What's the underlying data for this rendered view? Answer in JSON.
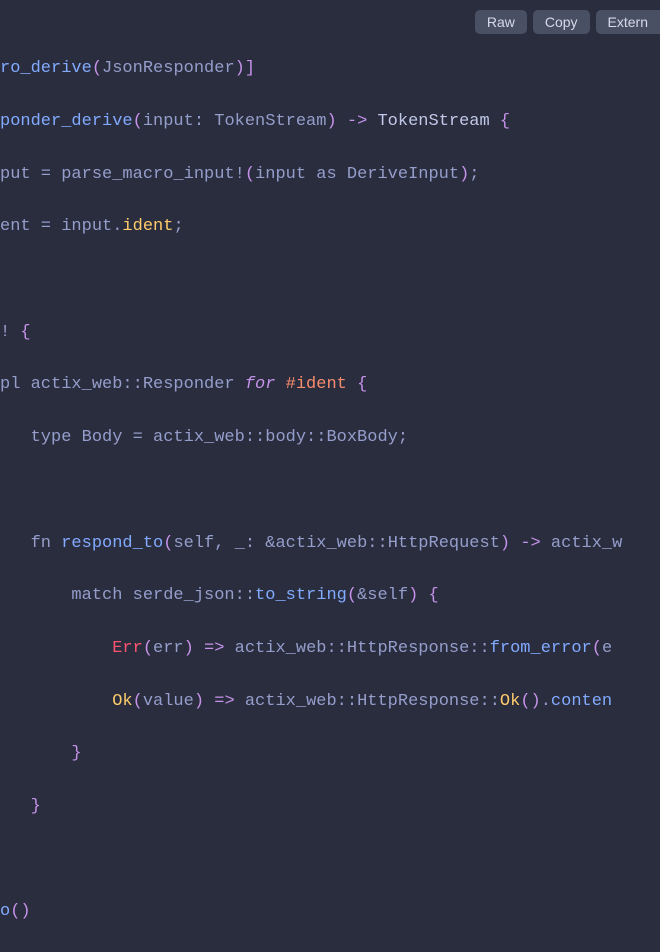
{
  "toolbar": {
    "raw": "Raw",
    "copy": "Copy",
    "extern": "Extern"
  },
  "code": {
    "l1_a": "ro_derive",
    "l1_b": "JsonResponder",
    "l2_a": "ponder_derive",
    "l2_b": "input: TokenStream",
    "l2_c": " TokenStream ",
    "l3_a": "put = parse_macro_input!",
    "l3_b": "input as DeriveInput",
    "l3_c": ";",
    "l4_a": "ent = input.",
    "l4_b": "ident",
    "l4_c": ";",
    "l5_a": "! ",
    "l6_a": "pl actix_web::Responder ",
    "l6_b": "for",
    "l6_c": " ",
    "l6_d": "#ident",
    "l6_e": " {",
    "l7_a": "   type Body = actix_web::body::BoxBody;",
    "l8_a": "   fn ",
    "l8_b": "respond_to",
    "l8_c": "self, _: &actix_web::HttpRequest",
    "l8_d": " actix_w",
    "l9_a": "       match serde_json::",
    "l9_b": "to_string",
    "l9_c": "&self",
    "l10_a": "           ",
    "l10_b": "Err",
    "l10_c": "err",
    "l10_d": " actix_web::HttpResponse::",
    "l10_e": "from_error",
    "l10_f": "e",
    "l11_a": "           ",
    "l11_b": "Ok",
    "l11_c": "value",
    "l11_d": " actix_web::HttpResponse::",
    "l11_e": "Ok",
    "l11_f": ".",
    "l11_g": "conten",
    "l12_a": "       ",
    "l13_a": "   ",
    "l14_a": "o"
  }
}
